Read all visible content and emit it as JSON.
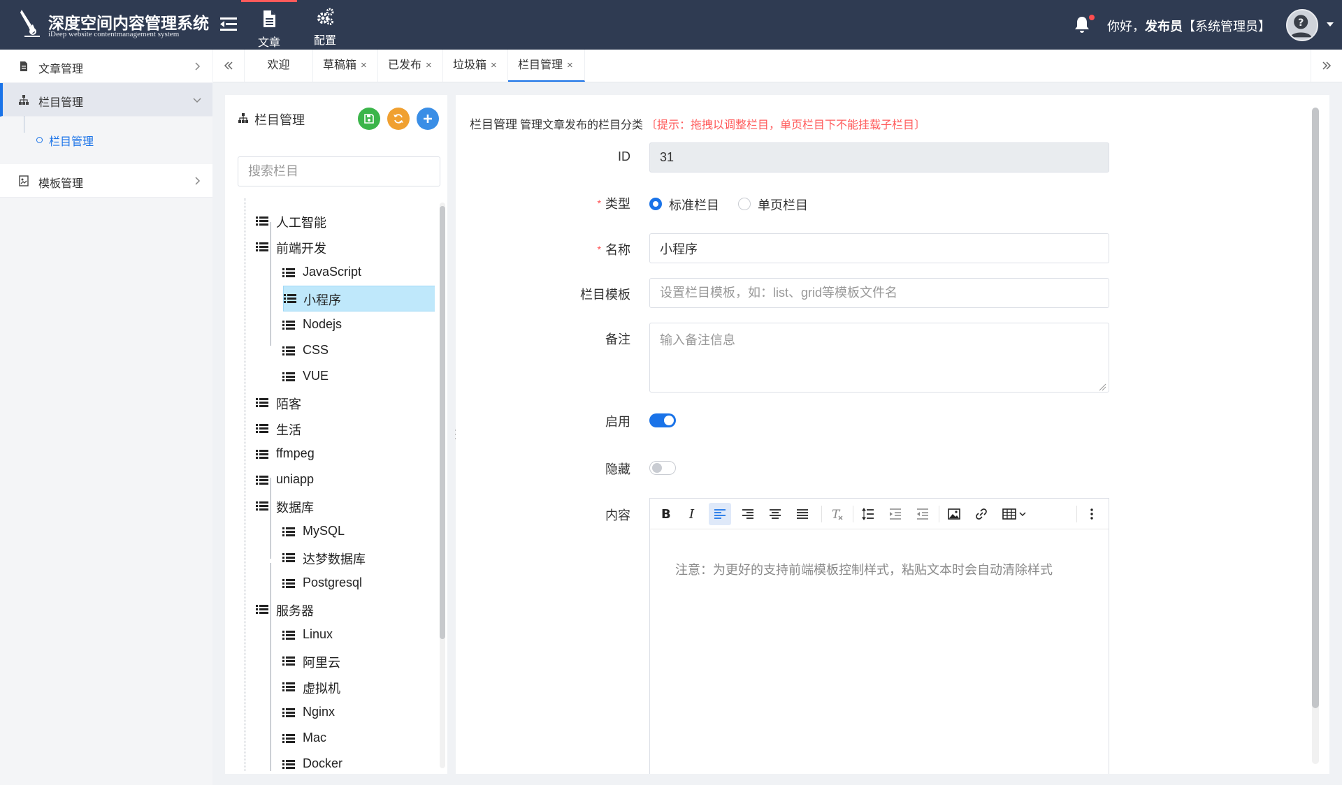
{
  "header": {
    "app_title": "深度空间内容管理系统",
    "app_subtitle": "iDeep website contentmanagement system",
    "nav": [
      {
        "label": "文章",
        "icon": "document-icon",
        "active": true
      },
      {
        "label": "配置",
        "icon": "gears-icon",
        "active": false
      }
    ],
    "greeting_prefix": "你好，",
    "user_name": "发布员",
    "user_role": "【系统管理员】",
    "accent_color": "#ff5a5a"
  },
  "sidebar": {
    "groups": [
      {
        "label": "文章管理",
        "icon": "document-icon",
        "open": false
      },
      {
        "label": "栏目管理",
        "icon": "sitemap-icon",
        "open": true,
        "children": [
          {
            "label": "栏目管理",
            "active": true
          }
        ]
      },
      {
        "label": "模板管理",
        "icon": "template-icon",
        "open": false
      }
    ]
  },
  "tabs": [
    {
      "label": "欢迎",
      "closable": false
    },
    {
      "label": "草稿箱",
      "closable": true
    },
    {
      "label": "已发布",
      "closable": true
    },
    {
      "label": "垃圾箱",
      "closable": true
    },
    {
      "label": "栏目管理",
      "closable": true,
      "active": true
    }
  ],
  "tab_close_glyph": "×",
  "tree_panel": {
    "title": "栏目管理",
    "buttons": [
      {
        "name": "save",
        "icon": "save-icon",
        "color": "#3bb54a"
      },
      {
        "name": "refresh",
        "icon": "refresh-icon",
        "color": "#f0a030"
      },
      {
        "name": "add",
        "icon": "plus-icon",
        "color": "#3a8ee6"
      }
    ],
    "search_placeholder": "搜索栏目",
    "nodes": [
      {
        "label": "人工智能",
        "level": 0
      },
      {
        "label": "前端开发",
        "level": 0,
        "expanded": true
      },
      {
        "label": "JavaScript",
        "level": 1
      },
      {
        "label": "小程序",
        "level": 1,
        "selected": true
      },
      {
        "label": "Nodejs",
        "level": 1
      },
      {
        "label": "CSS",
        "level": 1
      },
      {
        "label": "VUE",
        "level": 1
      },
      {
        "label": "陌客",
        "level": 0
      },
      {
        "label": "生活",
        "level": 0
      },
      {
        "label": "ffmpeg",
        "level": 0
      },
      {
        "label": "uniapp",
        "level": 0
      },
      {
        "label": "数据库",
        "level": 0,
        "expanded": true
      },
      {
        "label": "MySQL",
        "level": 1
      },
      {
        "label": "达梦数据库",
        "level": 1
      },
      {
        "label": "Postgresql",
        "level": 1
      },
      {
        "label": "服务器",
        "level": 0,
        "expanded": true
      },
      {
        "label": "Linux",
        "level": 1
      },
      {
        "label": "阿里云",
        "level": 1
      },
      {
        "label": "虚拟机",
        "level": 1
      },
      {
        "label": "Nginx",
        "level": 1
      },
      {
        "label": "Mac",
        "level": 1
      },
      {
        "label": "Docker",
        "level": 1
      }
    ]
  },
  "form": {
    "heading_title": "栏目管理",
    "heading_desc": "管理文章发布的栏目分类",
    "heading_hint": "〔提示：拖拽以调整栏目，单页栏目下不能挂载子栏目〕",
    "required_mark": "*",
    "id_label": "ID",
    "id_value": "31",
    "type_label": "类型",
    "type_options": [
      {
        "label": "标准栏目",
        "checked": true
      },
      {
        "label": "单页栏目",
        "checked": false
      }
    ],
    "name_label": "名称",
    "name_value": "小程序",
    "template_label": "栏目模板",
    "template_placeholder": "设置栏目模板，如：list、grid等模板文件名",
    "remark_label": "备注",
    "remark_placeholder": "输入备注信息",
    "enabled_label": "启用",
    "enabled": true,
    "hidden_label": "隐藏",
    "hidden": false,
    "content_label": "内容",
    "editor_placeholder": "注意：为更好的支持前端模板控制样式，粘贴文本时会自动清除样式",
    "primary_color": "#1a73e8"
  }
}
